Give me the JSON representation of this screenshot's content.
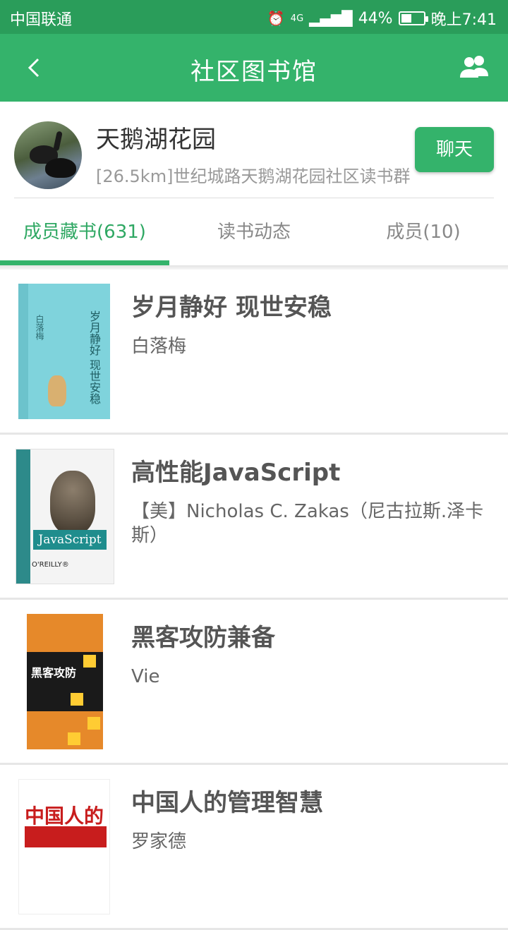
{
  "status_bar": {
    "carrier": "中国联通",
    "network": "4G",
    "battery": "44%",
    "time": "晚上7:41"
  },
  "title_bar": {
    "title": "社区图书馆",
    "back_icon": "chevron-left-icon",
    "members_icon": "group-icon"
  },
  "group": {
    "name": "天鹅湖花园",
    "description": "[26.5km]世纪城路天鹅湖花园社区读书群",
    "chat_label": "聊天"
  },
  "tabs": [
    {
      "label": "成员藏书(631)",
      "active": true
    },
    {
      "label": "读书动态",
      "active": false
    },
    {
      "label": "成员(10)",
      "active": false
    }
  ],
  "books": [
    {
      "title": "岁月静好 现世安稳",
      "author": "白落梅",
      "cover_text": "岁月静好 现世安稳"
    },
    {
      "title": "高性能JavaScript",
      "author": "【美】Nicholas C. Zakas（尼古拉斯.泽卡斯）",
      "cover_text": "JavaScript"
    },
    {
      "title": "黑客攻防兼备",
      "author": "Vie",
      "cover_text": "黑客攻防"
    },
    {
      "title": "中国人的管理智慧",
      "author": "罗家德",
      "cover_text": "中国人的"
    }
  ],
  "colors": {
    "primary": "#34b36b",
    "status_bar": "#2a9d5a"
  }
}
